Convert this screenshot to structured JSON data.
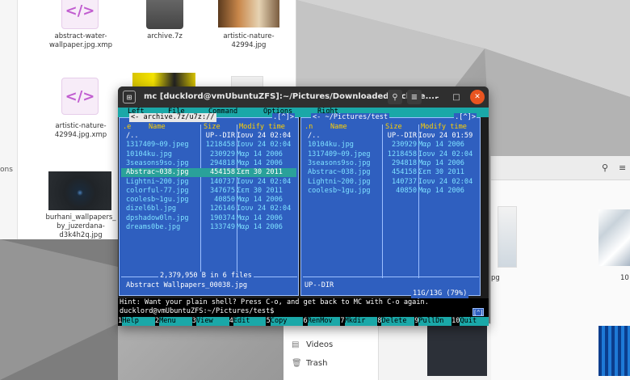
{
  "fm_left": {
    "side_text": "ons",
    "files": [
      {
        "label_l1": "abstract-water-",
        "label_l2": "wallpaper.jpg.xmp",
        "icon": "xmp-file-icon"
      },
      {
        "label_l1": "archive.7z",
        "label_l2": "",
        "icon": "archive-file-icon"
      },
      {
        "label_l1": "artistic-nature-",
        "label_l2": "42994.jpg",
        "icon": "image-thumbnail"
      },
      {
        "label_l1": "artistic-nature-",
        "label_l2": "42994.jpg.xmp",
        "icon": "xmp-file-icon"
      },
      {
        "label_l1": "burhani_wallpapers_",
        "label_l2": "by_juzerdana-",
        "label_l3": "d3k4h2q.jpg",
        "icon": "image-thumbnail"
      }
    ]
  },
  "fm_right": {
    "label_1": "pg",
    "label_2": "10"
  },
  "fm_bottom": {
    "items": [
      {
        "label": "Videos",
        "icon": "videos-icon"
      },
      {
        "label": "Trash",
        "icon": "trash-icon"
      }
    ]
  },
  "terminal": {
    "title": "mc [ducklord@vmUbuntuZFS]:~/Pictures/Downloaded/archive....",
    "menu": [
      "Left",
      "File",
      "Command",
      "Options",
      "Right"
    ],
    "left_panel": {
      "path": "archive.7z/u7z://",
      "corner": ".[^]>",
      "header": {
        "n": ".e",
        "name": "Name",
        "size": "Size",
        "mtime": "Modify time"
      },
      "rows": [
        {
          "name": "/..",
          "size": "UP--DIR",
          "mtime": "Ιουν 24 02:04",
          "type": "dir"
        },
        {
          "name": "1317409~09.jpeg",
          "size": "1218458",
          "mtime": "Ιουν 24 02:04",
          "type": "file"
        },
        {
          "name": "10104ku.jpg",
          "size": "230929",
          "mtime": "Μαρ 14  2006",
          "type": "file"
        },
        {
          "name": "3seasons9so.jpg",
          "size": "294818",
          "mtime": "Μαρ 14  2006",
          "type": "file"
        },
        {
          "name": "Abstrac~038.jpg",
          "size": "454158",
          "mtime": "Σεπ 30  2011",
          "type": "selected"
        },
        {
          "name": "Lightni~200.jpg",
          "size": "140737",
          "mtime": "Ιουν 24 02:04",
          "type": "file"
        },
        {
          "name": "colorful-77.jpg",
          "size": "347675",
          "mtime": "Σεπ 30  2011",
          "type": "file"
        },
        {
          "name": "coolesb~1gu.jpg",
          "size": "40850",
          "mtime": "Μαρ 14  2006",
          "type": "file"
        },
        {
          "name": "dizel6bl.jpg",
          "size": "126146",
          "mtime": "Ιουν 24 02:04",
          "type": "file"
        },
        {
          "name": "dpshadow0ln.jpg",
          "size": "190374",
          "mtime": "Μαρ 14  2006",
          "type": "file"
        },
        {
          "name": "dreams0be.jpg",
          "size": "133749",
          "mtime": "Μαρ 14  2006",
          "type": "file"
        }
      ],
      "summary": "2,379,950 B in 6 files",
      "status": "Abstract Wallpapers_00038.jpg"
    },
    "right_panel": {
      "path": "~/Pictures/test",
      "corner": ".[^]>",
      "header": {
        "n": ".n",
        "name": "Name",
        "size": "Size",
        "mtime": "Modify time"
      },
      "rows": [
        {
          "name": "/..",
          "size": "UP--DIR",
          "mtime": "Ιουν 24 01:59",
          "type": "dir"
        },
        {
          "name": "10104ku.jpg",
          "size": "230929",
          "mtime": "Μαρ 14  2006",
          "type": "file"
        },
        {
          "name": "1317409~09.jpeg",
          "size": "1218458",
          "mtime": "Ιουν 24 02:04",
          "type": "file"
        },
        {
          "name": "3seasons9so.jpg",
          "size": "294818",
          "mtime": "Μαρ 14  2006",
          "type": "file"
        },
        {
          "name": "Abstrac~038.jpg",
          "size": "454158",
          "mtime": "Σεπ 30  2011",
          "type": "file"
        },
        {
          "name": "Lightni~200.jpg",
          "size": "140737",
          "mtime": "Ιουν 24 02:04",
          "type": "file"
        },
        {
          "name": "coolesb~1gu.jpg",
          "size": "40850",
          "mtime": "Μαρ 14  2006",
          "type": "file"
        }
      ],
      "status": "UP--DIR",
      "disk": "11G/13G (79%)"
    },
    "hint": "Hint: Want your plain shell? Press C-o, and get back to MC with C-o again.",
    "prompt": "ducklord@vmUbuntuZFS:~/Pictures/test$",
    "prompt_tip": "[^]",
    "fkeys": [
      {
        "n": "1",
        "label": "Help"
      },
      {
        "n": "2",
        "label": "Menu"
      },
      {
        "n": "3",
        "label": "View"
      },
      {
        "n": "4",
        "label": "Edit"
      },
      {
        "n": "5",
        "label": "Copy"
      },
      {
        "n": "6",
        "label": "RenMov"
      },
      {
        "n": "7",
        "label": "Mkdir"
      },
      {
        "n": "8",
        "label": "Delete"
      },
      {
        "n": "9",
        "label": "PullDn"
      },
      {
        "n": "10",
        "label": "Quit"
      }
    ]
  }
}
